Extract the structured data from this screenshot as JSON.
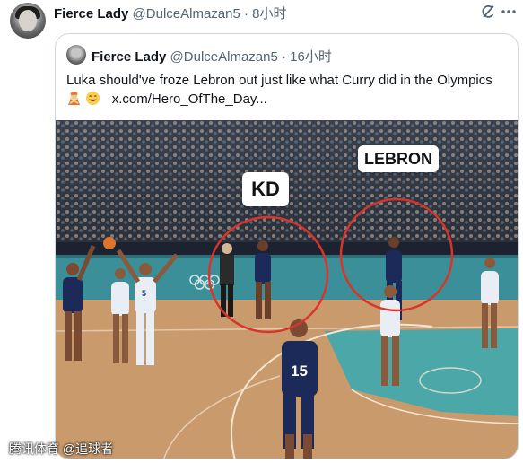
{
  "tweet": {
    "author_name": "Fierce Lady",
    "handle": "@DulceAlmazan5",
    "separator": "·",
    "time": "8小时"
  },
  "quoted_tweet": {
    "author_name": "Fierce Lady",
    "handle": "@DulceAlmazan5",
    "separator": "·",
    "time": "16小时",
    "text": "Luka should've froze Lebron out just like what Curry did in the Olympics",
    "link_text": "x.com/Hero_OfThe_Day...",
    "emojis": [
      "person-gesturing-no-emoji",
      "grinning-face-emoji"
    ]
  },
  "media": {
    "label_kd": "KD",
    "label_lebron": "LEBRON",
    "jersey_numbers": [
      "5",
      "15"
    ],
    "circle_color": "#d9342b",
    "court_color": "#c99a6c",
    "paint_color": "#4ba7a8"
  },
  "watermark": "腾讯体育 @追球者",
  "icons": {
    "grok": "grok-icon",
    "more": "more-icon"
  }
}
